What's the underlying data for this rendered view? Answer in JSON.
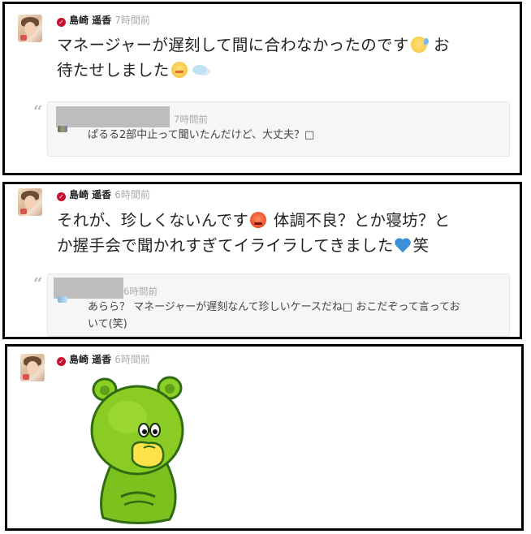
{
  "posts": [
    {
      "author": "島崎 遥香",
      "time": "7時間前",
      "message_line1": "マネージャーが遅刻して間に合わなかったのです",
      "message_line1_tail": " お",
      "message_line2": "待たせしました",
      "reply": {
        "time": "7時間前",
        "text": "ぱるる2部中止って聞いたんだけど、大丈夫？□"
      }
    },
    {
      "author": "島崎 遥香",
      "time": "6時間前",
      "message_line1a": "それが、珍しくないんです",
      "message_line1b": " 体調不良？とか寝坊？と",
      "message_line2a": "か握手会で聞かれすぎてイライラしてきました",
      "message_line2b": "笑",
      "reply": {
        "time": "6時間前",
        "text_line1": "あらら？ マネージャーが遅刻なんて珍しいケースだね□ おこだぞって言ってお",
        "text_line2": "いて(笑)"
      }
    },
    {
      "author": "島崎 遥香",
      "time": "6時間前",
      "sticker": "green-bear-sticker"
    }
  ],
  "icons": {
    "verified": "verified-badge-icon",
    "quote": "quote-icon",
    "emoji_1": "sweat-face-emoji",
    "emoji_2": "grimace-face-emoji",
    "emoji_3": "dash-puff-emoji",
    "emoji_4": "angry-face-emoji",
    "emoji_5": "broken-heart-emoji"
  },
  "colors": {
    "badge": "#c8102e",
    "time": "#aaaaaa",
    "bear_body": "#7cc21e",
    "bear_outline": "#2f6b12"
  }
}
